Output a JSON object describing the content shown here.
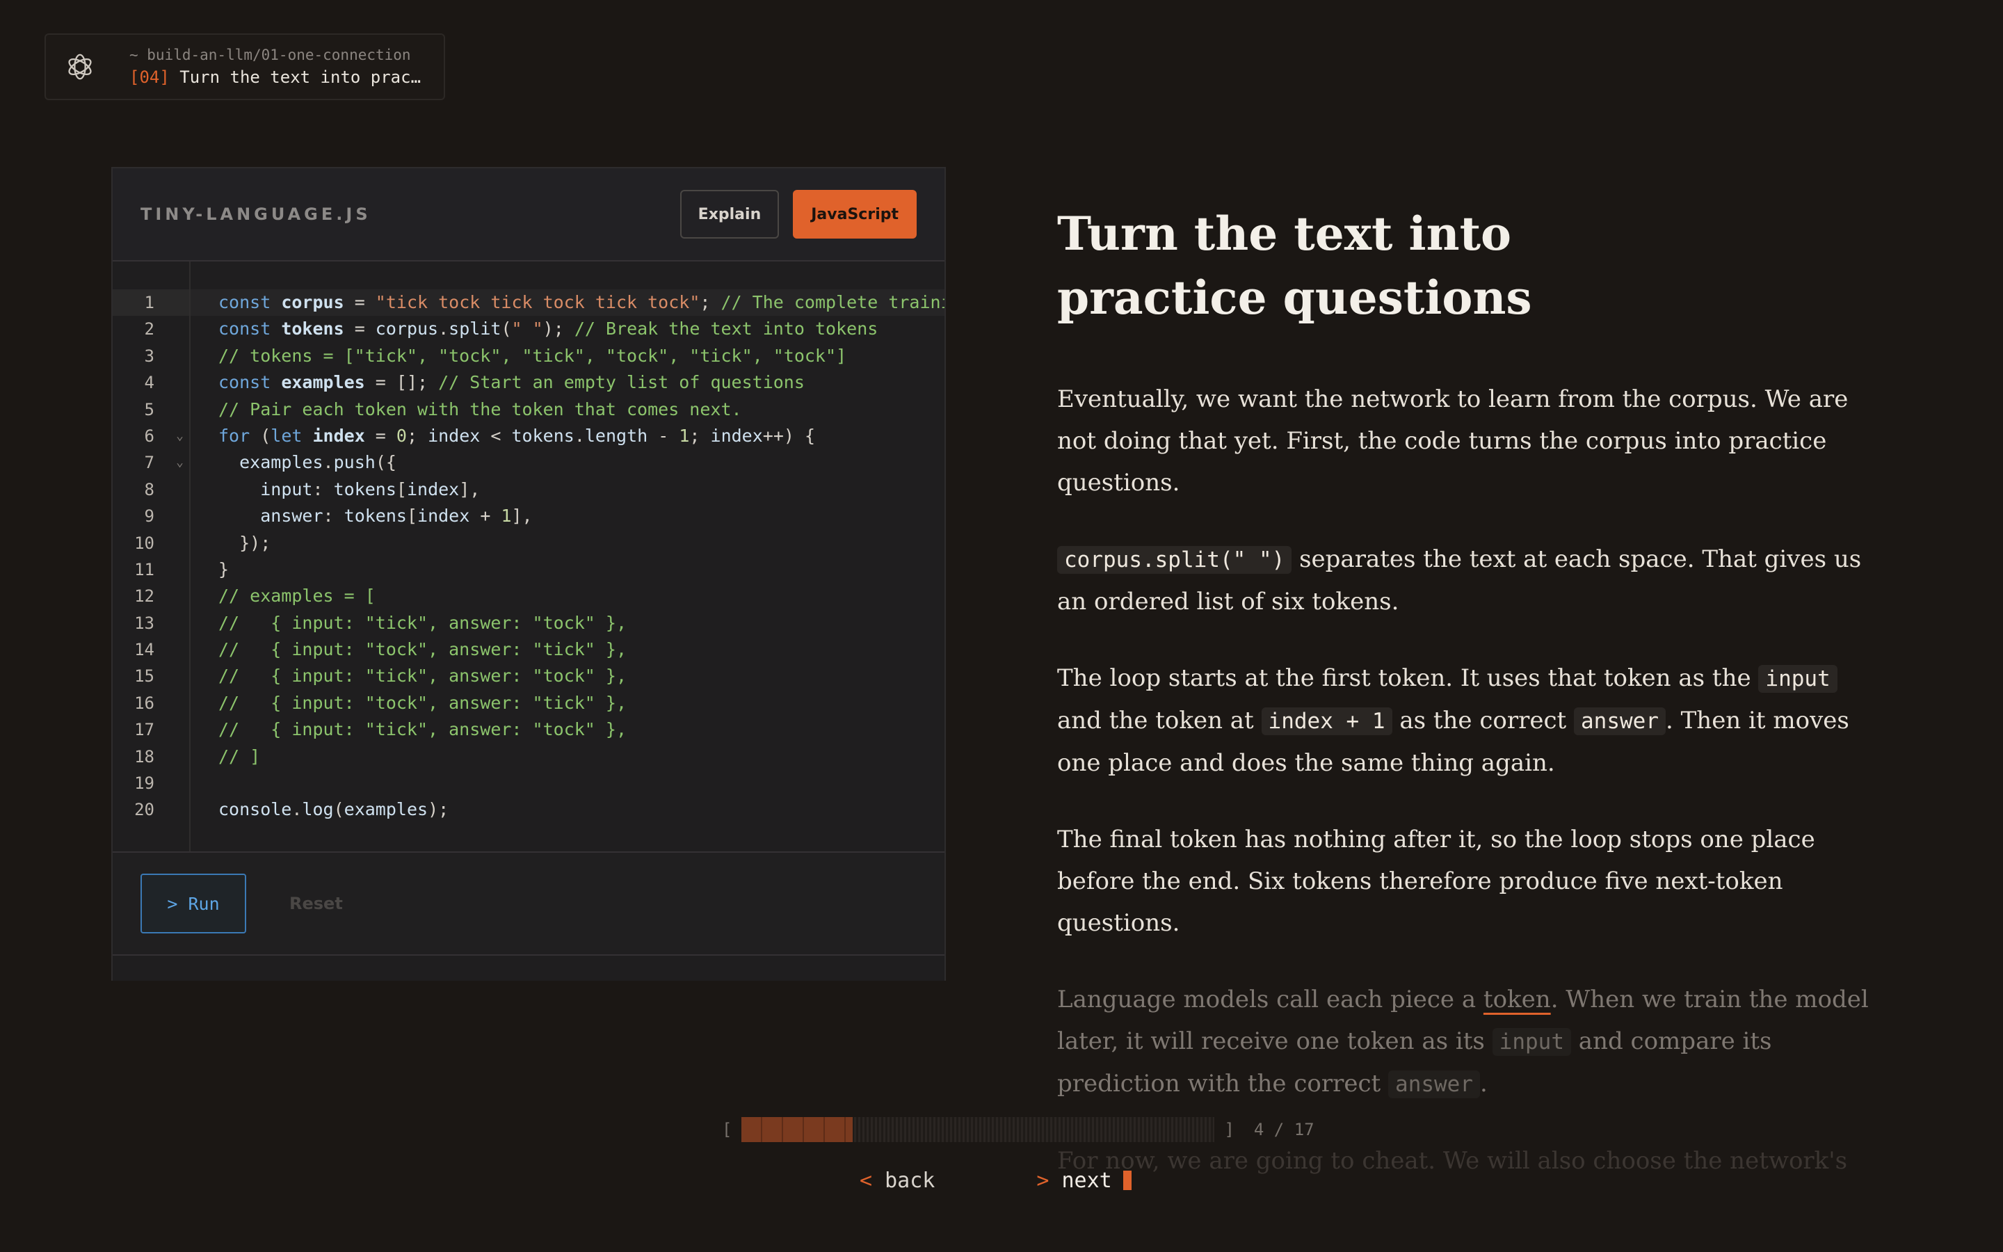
{
  "breadcrumb": {
    "path": "~ build-an-llm/01-one-connection",
    "step_num": "[04]",
    "step_title": "Turn the text into practice questions"
  },
  "editor": {
    "filename": "TINY-LANGUAGE.JS",
    "explain_label": "Explain",
    "language_label": "JavaScript",
    "run_label": "> Run",
    "reset_label": "Reset",
    "active_line": 1,
    "line_numbers": [
      "1",
      "2",
      "3",
      "4",
      "5",
      "6",
      "7",
      "8",
      "9",
      "10",
      "11",
      "12",
      "13",
      "14",
      "15",
      "16",
      "17",
      "18",
      "19",
      "20"
    ],
    "code_lines": [
      "const corpus = \"tick tock tick tock tick tock\"; // The complete training text",
      "const tokens = corpus.split(\" \"); // Break the text into tokens",
      "// tokens = [\"tick\", \"tock\", \"tick\", \"tock\", \"tick\", \"tock\"]",
      "const examples = []; // Start an empty list of questions",
      "// Pair each token with the token that comes next.",
      "for (let index = 0; index < tokens.length - 1; index++) {",
      "  examples.push({",
      "    input: tokens[index],",
      "    answer: tokens[index + 1],",
      "  });",
      "}",
      "// examples = [",
      "//   { input: \"tick\", answer: \"tock\" },",
      "//   { input: \"tock\", answer: \"tick\" },",
      "//   { input: \"tick\", answer: \"tock\" },",
      "//   { input: \"tock\", answer: \"tick\" },",
      "//   { input: \"tick\", answer: \"tock\" },",
      "// ]",
      "",
      "console.log(examples);"
    ]
  },
  "article": {
    "title": "Turn the text into practice questions",
    "p1": "Eventually, we want the network to learn from the corpus. We are not doing that yet. First, the code turns the corpus into practice questions.",
    "p2_code": "corpus.split(\" \")",
    "p2_text": " separates the text at each space. That gives us an ordered list of six tokens.",
    "p3_a": "The loop starts at the first token. It uses that token as the ",
    "p3_code1": "input",
    "p3_b": " and the token at ",
    "p3_code2": "index + 1",
    "p3_c": " as the correct ",
    "p3_code3": "answer",
    "p3_d": ". Then it moves one place and does the same thing again.",
    "p4": "The final token has nothing after it, so the loop stops one place before the end. Six tokens therefore produce five next-token questions.",
    "p5_a": "Language models call each piece a ",
    "p5_term": "token",
    "p5_b": ". When we train the model later, it will receive one token as its ",
    "p5_code1": "input",
    "p5_c": " and compare its prediction with the correct ",
    "p5_code2": "answer",
    "p5_d": ".",
    "p6": "For now, we are going to cheat. We will also choose the network's"
  },
  "progress": {
    "bracket_open": "[",
    "bracket_close": "]",
    "current": 4,
    "total": 17,
    "label": "4 / 17"
  },
  "nav": {
    "back_chevron": "<",
    "back_label": "back",
    "next_chevron": ">",
    "next_label": "next"
  },
  "icons": {
    "logo": "openai-knot-icon",
    "fold": "chevron-down-icon"
  },
  "colors": {
    "accent": "#e0622b",
    "background": "#1b1714"
  }
}
